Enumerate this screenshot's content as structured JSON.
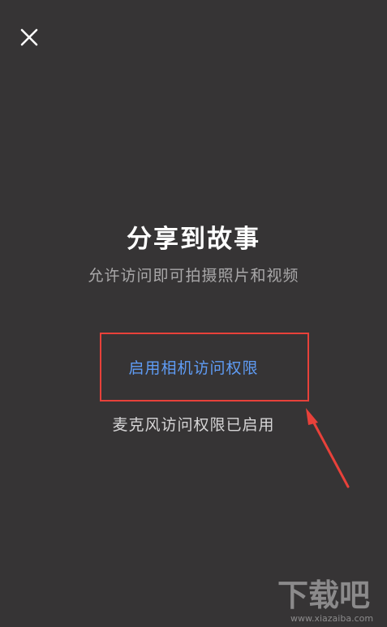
{
  "header": {
    "close_icon": "close-icon"
  },
  "main": {
    "title": "分享到故事",
    "subtitle": "允许访问即可拍摄照片和视频",
    "enable_camera_label": "启用相机访问权限",
    "mic_status": "麦克风访问权限已启用"
  },
  "annotation": {
    "highlight_color": "#e8413a",
    "arrow_color": "#e8413a"
  },
  "watermark": {
    "logo_text": "下载吧",
    "url_text": "www.xiazaiba.com"
  },
  "colors": {
    "background": "#363435",
    "link": "#5f9cf5",
    "title": "#ffffff",
    "subtitle": "#a9a8a9"
  }
}
